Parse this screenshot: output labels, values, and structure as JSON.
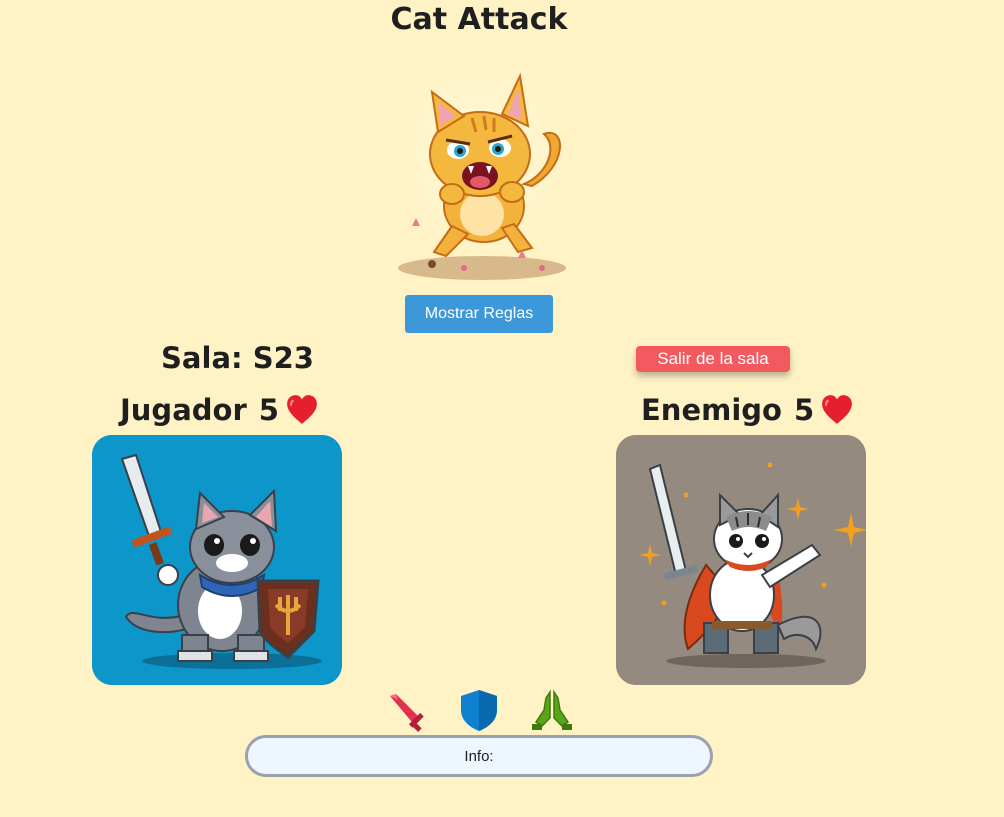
{
  "game": {
    "title": "Cat Attack"
  },
  "controls": {
    "rules_button": "Mostrar Reglas",
    "exit_button": "Salir de la sala"
  },
  "room": {
    "label": "Sala: S23"
  },
  "player": {
    "name": "Jugador",
    "lives": "5",
    "card_bg": "#0d96c9"
  },
  "enemy": {
    "name": "Enemigo",
    "lives": "5",
    "card_bg": "#948a80"
  },
  "actions": [
    {
      "icon": "sword-icon",
      "color": "#e0314e"
    },
    {
      "icon": "shield-icon",
      "color": "#0f7fcf"
    },
    {
      "icon": "praying-hands-icon",
      "color": "#5aa51a"
    }
  ],
  "info": {
    "label": "Info:"
  },
  "colors": {
    "background": "#fff3c6",
    "rules_button": "#3d98d9",
    "exit_button": "#f25a5f",
    "heart": "#e5202c"
  }
}
